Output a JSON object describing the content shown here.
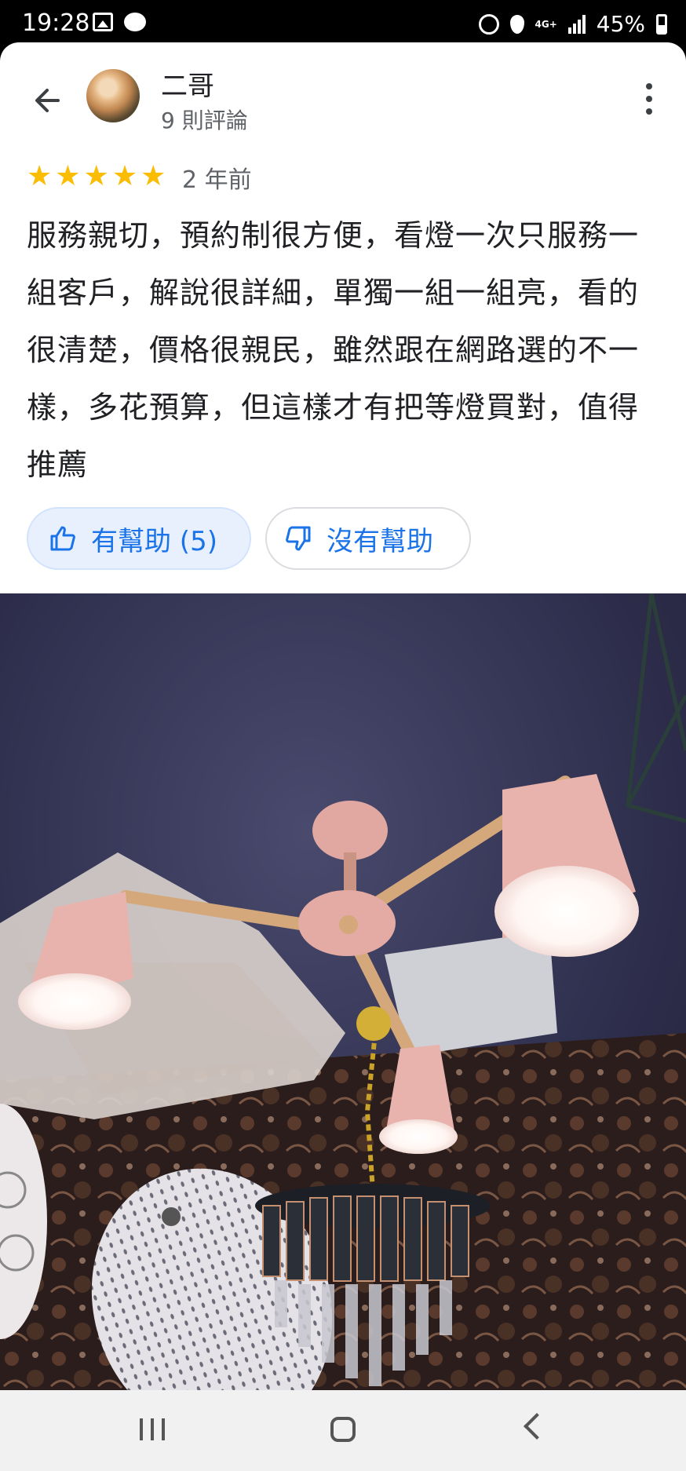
{
  "status_bar": {
    "time": "19:28",
    "network": "4G+",
    "battery": "45%"
  },
  "reviewer": {
    "name": "二哥",
    "review_count": "9 則評論"
  },
  "review": {
    "rating": 5,
    "age": "2 年前",
    "text": "服務親切，預約制很方便，看燈一次只服務一組客戶，解說很詳細，單獨一組一組亮，看的很清楚，價格很親民，雖然跟在網路選的不一樣，多花預算，但這樣才有把等燈買對，值得推薦"
  },
  "actions": {
    "helpful_label": "有幫助 (5)",
    "not_helpful_label": "沒有幫助"
  },
  "colors": {
    "star": "#fbbc04",
    "accent": "#1a73e8",
    "helpful_bg": "#e8f0fe"
  }
}
